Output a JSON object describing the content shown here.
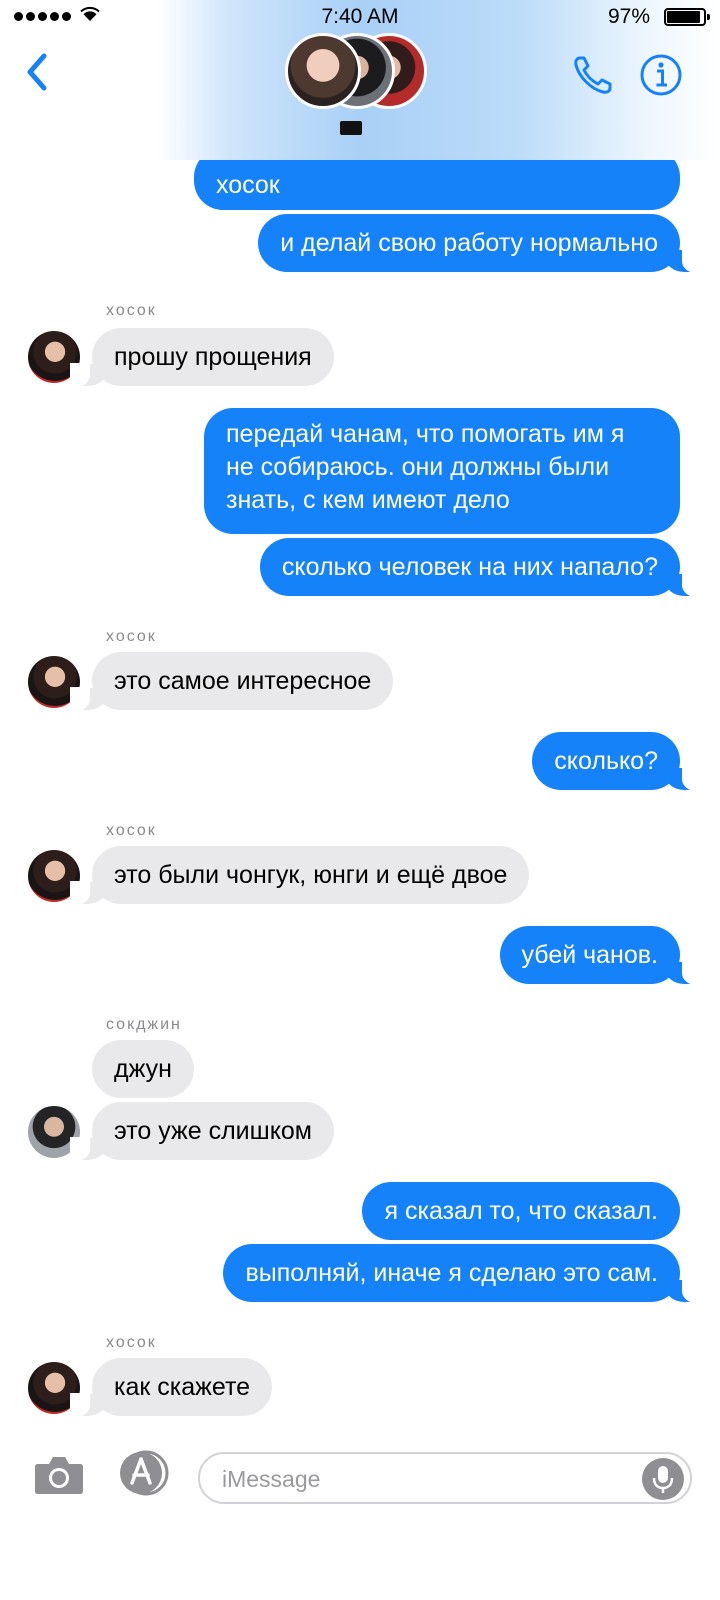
{
  "status_bar": {
    "time": "7:40 AM",
    "battery": "97%"
  },
  "header": {
    "back_icon": "chevron-left-icon",
    "phone_icon": "phone-icon",
    "info_icon": "info-icon",
    "accent_color": "#1582f9"
  },
  "messages": [
    {
      "direction": "out",
      "text": "хосок"
    },
    {
      "direction": "out",
      "text": "и делай свою работу нормально"
    },
    {
      "direction": "in",
      "sender": "хосок",
      "text": "прошу прощения"
    },
    {
      "direction": "out",
      "text": "передай чанам, что помогать им я не собираюсь. они должны были знать, с кем имеют дело"
    },
    {
      "direction": "out",
      "text": "сколько человек на них напало?"
    },
    {
      "direction": "in",
      "sender": "хосок",
      "text": "это самое интересное"
    },
    {
      "direction": "out",
      "text": "сколько?"
    },
    {
      "direction": "in",
      "sender": "хосок",
      "text": "это были чонгук, юнги и ещё двое"
    },
    {
      "direction": "out",
      "text": "убей чанов."
    },
    {
      "direction": "in",
      "sender": "сокджин",
      "text": "джун"
    },
    {
      "direction": "in",
      "sender": "сокджин",
      "text": "это уже слишком"
    },
    {
      "direction": "out",
      "text": "я сказал то, что сказал."
    },
    {
      "direction": "out",
      "text": "выполняй, иначе я сделаю это сам."
    },
    {
      "direction": "in",
      "sender": "хосок",
      "text": "как скажете"
    }
  ],
  "input_bar": {
    "placeholder": "iMessage",
    "camera_icon": "camera-icon",
    "appstore_icon": "app-store-icon",
    "mic_icon": "microphone-icon"
  }
}
